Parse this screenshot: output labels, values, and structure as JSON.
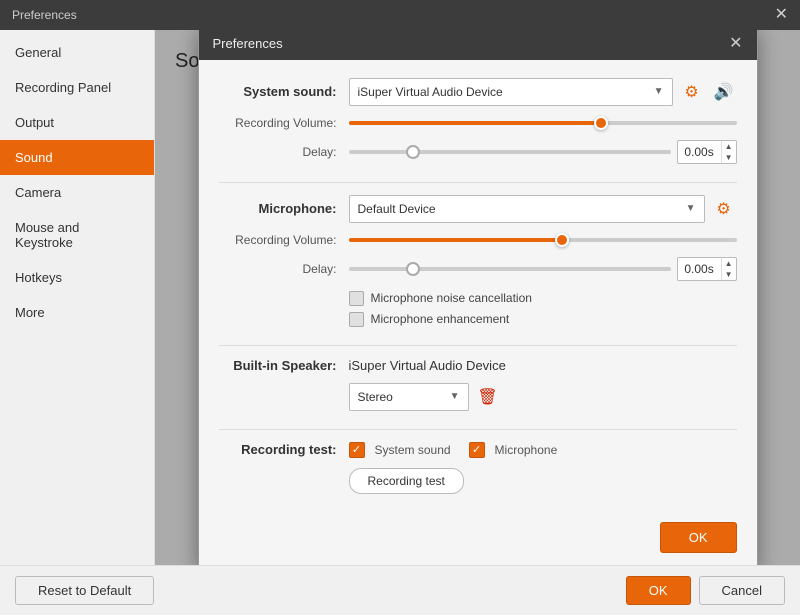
{
  "titleBar": {
    "title": "Preferences",
    "closeLabel": "✕"
  },
  "sidebar": {
    "items": [
      {
        "id": "general",
        "label": "General",
        "active": false
      },
      {
        "id": "recording-panel",
        "label": "Recording Panel",
        "active": false
      },
      {
        "id": "output",
        "label": "Output",
        "active": false
      },
      {
        "id": "sound",
        "label": "Sound",
        "active": true
      },
      {
        "id": "camera",
        "label": "Camera",
        "active": false
      },
      {
        "id": "mouse-keystroke",
        "label": "Mouse and Keystroke",
        "active": false
      },
      {
        "id": "hotkeys",
        "label": "Hotkeys",
        "active": false
      },
      {
        "id": "more",
        "label": "More",
        "active": false
      }
    ]
  },
  "panelTitle": "Sound",
  "bottomBar": {
    "resetLabel": "Reset to Default",
    "okLabel": "OK",
    "cancelLabel": "Cancel"
  },
  "dialog": {
    "title": "Preferences",
    "closeLabel": "✕",
    "systemSoundLabel": "System sound:",
    "systemSoundValue": "iSuper Virtual Audio Device",
    "recordingVolumeLabel": "Recording Volume:",
    "systemVolumePercent": 65,
    "delayLabel": "Delay:",
    "systemDelayValue": "0.00s",
    "systemDelayPercent": 20,
    "microphoneLabel": "Microphone:",
    "microphoneValue": "Default Device",
    "micVolumePercent": 55,
    "micDelayValue": "0.00s",
    "micDelayPercent": 20,
    "noiseCancelLabel": "Microphone noise cancellation",
    "enhancementLabel": "Microphone enhancement",
    "builtInSpeakerLabel": "Built-in Speaker:",
    "builtInSpeakerValue": "iSuper Virtual Audio Device",
    "stereoLabel": "Stereo",
    "recordingTestLabel": "Recording test:",
    "systemSoundCheckLabel": "System sound",
    "microphoneCheckLabel": "Microphone",
    "recordingTestBtnLabel": "Recording test",
    "okLabel": "OK"
  }
}
